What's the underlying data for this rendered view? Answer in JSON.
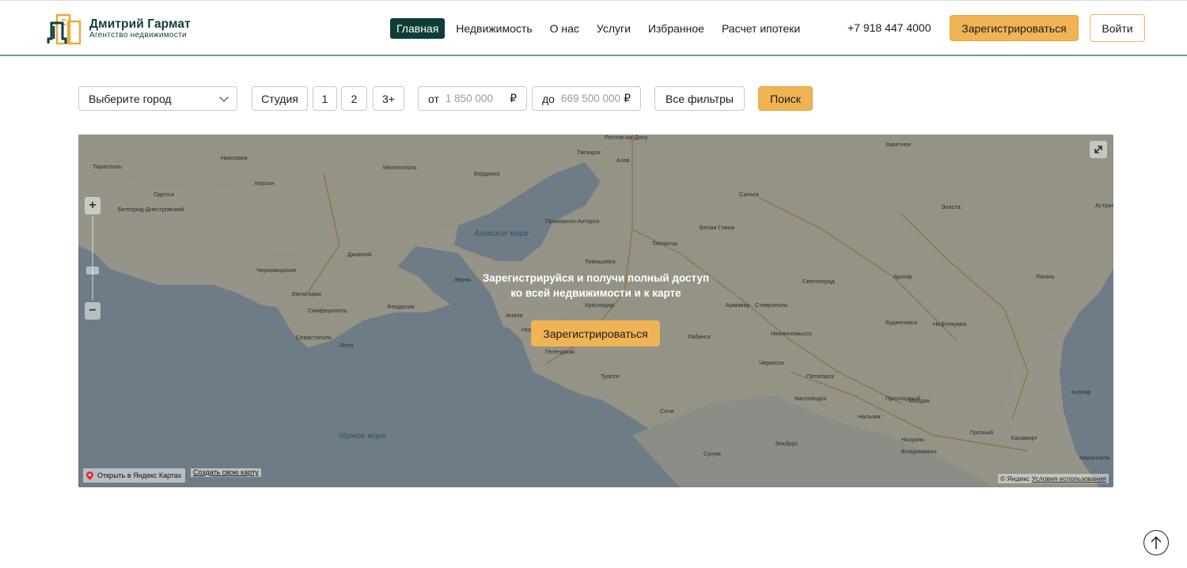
{
  "header": {
    "logo": {
      "title": "Дмитрий Гармат",
      "subtitle": "Агентство недвижимости"
    },
    "nav": [
      {
        "label": "Главная",
        "active": true
      },
      {
        "label": "Недвижимость",
        "active": false
      },
      {
        "label": "О нас",
        "active": false
      },
      {
        "label": "Услуги",
        "active": false
      },
      {
        "label": "Избранное",
        "active": false
      },
      {
        "label": "Расчет ипотеки",
        "active": false
      }
    ],
    "phone": "+7 918 447 4000",
    "register_label": "Зарегистрироваться",
    "login_label": "Войти"
  },
  "filters": {
    "city": "Выберите город",
    "rooms": [
      "Студия",
      "1",
      "2",
      "3+"
    ],
    "price_from": {
      "label": "от",
      "value": "1 850 000",
      "currency": "₽"
    },
    "price_to": {
      "label": "до",
      "value": "669 500 000",
      "currency": "₽"
    },
    "all_filters": "Все фильтры",
    "search": "Поиск"
  },
  "map": {
    "cta_line1": "Зарегистрируйся и получи полный доступ",
    "cta_line2": "ко всей недвижимости и к карте",
    "cta_button": "Зарегистрироваться",
    "zoom_in": "+",
    "zoom_out": "−",
    "open_in_yandex": "Открыть в Яндекс Картах",
    "create_map": "Создать свою карту",
    "copyright": "© Яндекс",
    "terms": "Условия использования",
    "labels": [
      "Ростов-на-Дону",
      "Таганрог",
      "Азов",
      "Бердянск",
      "Мелитополь",
      "Николаев",
      "Херсон",
      "Тирасполь",
      "Одесса",
      "Белгород-Днестровский",
      "Азовское море",
      "Приморско-Ахтарск",
      "Тимашевск",
      "Краснодар",
      "Керчь",
      "Феодосия",
      "Джанкой",
      "Черноморское",
      "Евпатория",
      "Симферополь",
      "Севастополь",
      "Ялта",
      "Анапа",
      "Новороссийск",
      "Геленджик",
      "Туапсе",
      "Сочи",
      "Сухум",
      "Чёрное море",
      "Тихорецк",
      "Белая Глина",
      "Сальск",
      "Заветное",
      "Элиста",
      "Астрахань",
      "Светлоград",
      "Арзгир",
      "Лагань",
      "Армавир",
      "Ставрополь",
      "Невинномысск",
      "Лабинск",
      "Буденновск",
      "Нефтекумск",
      "Черкесск",
      "Пятигорск",
      "Кисловодск",
      "Нальчик",
      "Прохладный",
      "Моздок",
      "Кизляр",
      "Грозный",
      "Хасавюрт",
      "Махачкала",
      "Назрань",
      "Владикавказ",
      "Эльбрус"
    ]
  }
}
